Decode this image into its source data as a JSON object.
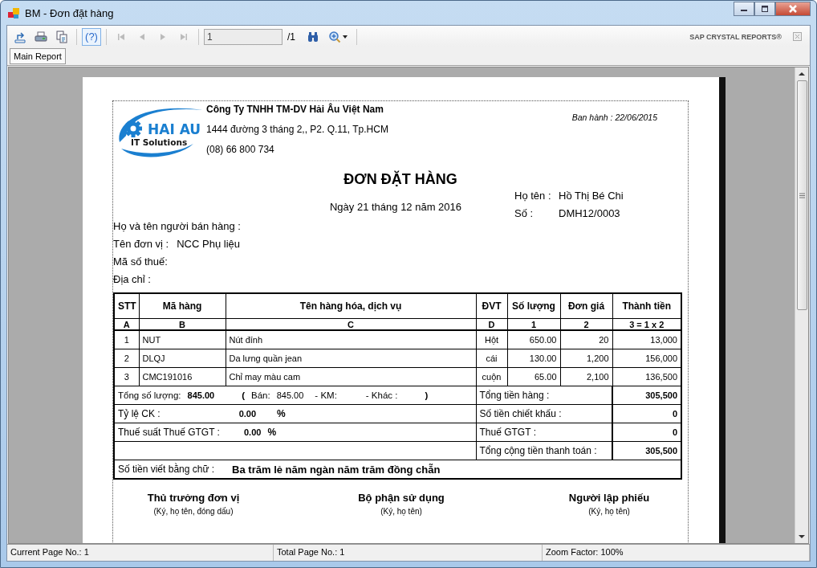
{
  "window": {
    "title": "BM - Đơn đặt hàng"
  },
  "toolbar": {
    "buttons": [
      {
        "kind": "export",
        "disabled": false,
        "on": false
      },
      {
        "kind": "print",
        "disabled": false,
        "on": false
      },
      {
        "kind": "copy",
        "disabled": false,
        "on": false
      },
      {
        "kind": "help",
        "label": "(?)",
        "disabled": false,
        "on": true
      },
      {
        "kind": "first",
        "disabled": true,
        "on": false
      },
      {
        "kind": "prev",
        "disabled": true,
        "on": false
      },
      {
        "kind": "next",
        "disabled": true,
        "on": false
      },
      {
        "kind": "last",
        "disabled": true,
        "on": false
      }
    ],
    "page_field": {
      "value": "1"
    },
    "page_total": "/1",
    "tools": [
      {
        "kind": "find"
      },
      {
        "kind": "zoom"
      }
    ],
    "brand": "SAP CRYSTAL REPORTS®"
  },
  "tabs": [
    {
      "label": "Main Report",
      "selected": true
    }
  ],
  "report": {
    "logo": {
      "name": "HAI AU",
      "tagline": "IT Solutions"
    },
    "company": {
      "name": "Công Ty TNHH TM-DV Hải Âu Việt Nam",
      "address": "1444 đường 3 tháng 2,, P2. Q.11, Tp.HCM",
      "phone": "(08) 66 800 734"
    },
    "issued": "Ban hành : 22/06/2015",
    "title": "ĐƠN ĐẶT HÀNG",
    "date": "Ngày 21 tháng 12 năm 2016",
    "buyer": [
      {
        "label": "Họ tên :",
        "value": "Hồ Thị Bé Chi"
      },
      {
        "label": "Số :",
        "value": "DMH12/0003"
      }
    ],
    "seller": [
      {
        "label": "Họ và tên người bán hàng :"
      },
      {
        "label": "Tên đơn vị :",
        "value": "NCC Phụ liệu"
      },
      {
        "label": "Mã số thuế:"
      },
      {
        "label": "Địa chỉ :"
      }
    ],
    "table": {
      "columns": [
        {
          "header": "STT",
          "code": "A"
        },
        {
          "header": "Mã hàng",
          "code": "B"
        },
        {
          "header": "Tên hàng hóa, dịch vụ",
          "code": "C"
        },
        {
          "header": "ĐVT",
          "code": "D"
        },
        {
          "header": "Số lượng",
          "code": "1"
        },
        {
          "header": "Đơn giá",
          "code": "2"
        },
        {
          "header": "Thành tiền",
          "code": "3 = 1 x 2"
        }
      ],
      "rows": [
        [
          "1",
          "NUT",
          "Nút đính",
          "Hột",
          "650.00",
          "20",
          "13,000"
        ],
        [
          "2",
          "DLQJ",
          "Da lưng quần jean",
          "cái",
          "130.00",
          "1,200",
          "156,000"
        ],
        [
          "3",
          "CMC191016",
          "Chỉ may màu cam",
          "cuộn",
          "65.00",
          "2,100",
          "136,500"
        ]
      ]
    },
    "summary": [
      {
        "kind": "totals",
        "left": [
          {
            "kind": "label",
            "text": "Tổng số lượng:"
          },
          {
            "kind": "value",
            "text": "845.00"
          },
          {
            "kind": "paren",
            "text": "("
          },
          {
            "kind": "label",
            "text": "Bán:"
          },
          {
            "kind": "plain",
            "text": "845.00"
          },
          {
            "kind": "label",
            "text": "- KM:"
          },
          {
            "kind": "label",
            "text": "- Khác :"
          },
          {
            "kind": "paren",
            "text": ")"
          }
        ],
        "label": "Tổng tiền hàng :",
        "value": "305,500"
      },
      {
        "kind": "rate",
        "left": [
          {
            "kind": "label",
            "text": "Tỷ lệ CK :"
          },
          {
            "kind": "value",
            "text": "0.00"
          },
          {
            "kind": "paren",
            "text": "%"
          }
        ],
        "label": "Số tiền chiết khấu :",
        "value": "0"
      },
      {
        "kind": "tax",
        "left": [
          {
            "kind": "label",
            "text": "Thuế suất Thuế GTGT :"
          },
          {
            "kind": "value",
            "text": "0.00"
          },
          {
            "kind": "paren",
            "text": "%"
          }
        ],
        "label": "Thuế GTGT :",
        "value": "0"
      },
      {
        "kind": "grand",
        "label": "Tổng cộng tiền thanh toán :",
        "value": "305,500"
      }
    ],
    "in_words": {
      "label": "Số tiền viết bằng chữ :",
      "value": "Ba trăm lẻ năm ngàn năm trăm đồng chẵn"
    },
    "signatures": [
      {
        "title": "Thủ trưởng đơn vị",
        "note": "(Ký, họ tên, đóng dấu)"
      },
      {
        "title": "Bộ phận sử dụng",
        "note": "(Ký, họ tên)"
      },
      {
        "title": "Người lập phiếu",
        "note": "(Ký, họ tên)"
      }
    ]
  },
  "status_bar": [
    "Current Page No.: 1",
    "Total Page No.: 1",
    "Zoom Factor: 100%"
  ]
}
